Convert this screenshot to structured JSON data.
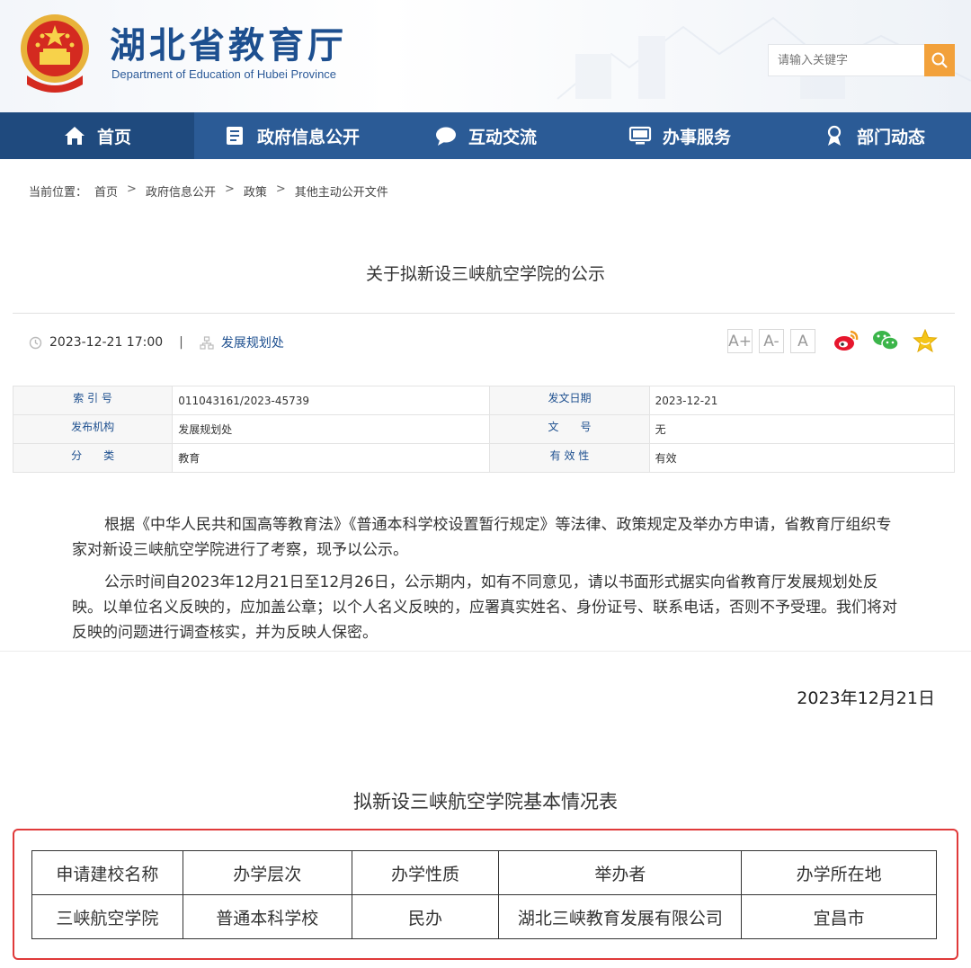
{
  "header": {
    "title": "湖北省教育厅",
    "subtitle": "Department of Education of Hubei Province",
    "search_placeholder": "请输入关键字",
    "colors": {
      "brand": "#1d4f8f",
      "nav": "#2b5b96",
      "search_button": "#f2a13b"
    }
  },
  "nav": {
    "items": [
      {
        "label": "首页",
        "icon": "home-icon"
      },
      {
        "label": "政府信息公开",
        "icon": "document-icon"
      },
      {
        "label": "互动交流",
        "icon": "chat-icon"
      },
      {
        "label": "办事服务",
        "icon": "monitor-icon"
      },
      {
        "label": "部门动态",
        "icon": "badge-icon"
      }
    ]
  },
  "breadcrumb": {
    "prefix": "当前位置：",
    "items": [
      "首页",
      "政府信息公开",
      "政策",
      "其他主动公开文件"
    ]
  },
  "article": {
    "title": "关于拟新设三峡航空学院的公示",
    "datetime": "2023-12-21 17:00",
    "separator": "|",
    "department": "发展规划处",
    "font_buttons": [
      "A+",
      "A-",
      "A"
    ]
  },
  "info": {
    "rows": [
      {
        "k1": "索 引 号",
        "v1": "011043161/2023-45739",
        "k2": "发文日期",
        "v2": "2023-12-21"
      },
      {
        "k1": "发布机构",
        "v1": "发展规划处",
        "k2": "文　　号",
        "v2": "无"
      },
      {
        "k1": "分　　类",
        "v1": "教育",
        "k2": "有 效 性",
        "v2": "有效"
      }
    ]
  },
  "body": {
    "p1": "根据《中华人民共和国高等教育法》《普通本科学校设置暂行规定》等法律、政策规定及举办方申请，省教育厅组织专家对新设三峡航空学院进行了考察，现予以公示。",
    "p2": "公示时间自2023年12月21日至12月26日，公示期内，如有不同意见，请以书面形式据实向省教育厅发展规划处反映。以单位名义反映的，应加盖公章；以个人名义反映的，应署真实姓名、身份证号、联系电话，否则不予受理。我们将对反映的问题进行调查核实，并为反映人保密。",
    "date": "2023年12月21日",
    "table_title": "拟新设三峡航空学院基本情况表"
  },
  "school_table": {
    "headers": [
      "申请建校名称",
      "办学层次",
      "办学性质",
      "举办者",
      "办学所在地"
    ],
    "row": [
      "三峡航空学院",
      "普通本科学校",
      "民办",
      "湖北三峡教育发展有限公司",
      "宜昌市"
    ]
  }
}
